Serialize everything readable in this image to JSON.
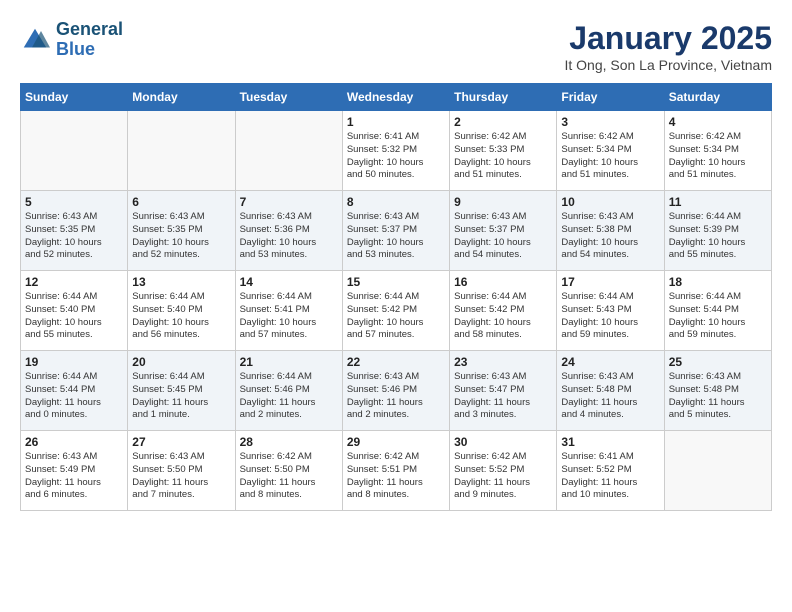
{
  "logo": {
    "line1": "General",
    "line2": "Blue"
  },
  "title": "January 2025",
  "location": "It Ong, Son La Province, Vietnam",
  "weekdays": [
    "Sunday",
    "Monday",
    "Tuesday",
    "Wednesday",
    "Thursday",
    "Friday",
    "Saturday"
  ],
  "weeks": [
    [
      {
        "day": "",
        "text": ""
      },
      {
        "day": "",
        "text": ""
      },
      {
        "day": "",
        "text": ""
      },
      {
        "day": "1",
        "text": "Sunrise: 6:41 AM\nSunset: 5:32 PM\nDaylight: 10 hours\nand 50 minutes."
      },
      {
        "day": "2",
        "text": "Sunrise: 6:42 AM\nSunset: 5:33 PM\nDaylight: 10 hours\nand 51 minutes."
      },
      {
        "day": "3",
        "text": "Sunrise: 6:42 AM\nSunset: 5:34 PM\nDaylight: 10 hours\nand 51 minutes."
      },
      {
        "day": "4",
        "text": "Sunrise: 6:42 AM\nSunset: 5:34 PM\nDaylight: 10 hours\nand 51 minutes."
      }
    ],
    [
      {
        "day": "5",
        "text": "Sunrise: 6:43 AM\nSunset: 5:35 PM\nDaylight: 10 hours\nand 52 minutes."
      },
      {
        "day": "6",
        "text": "Sunrise: 6:43 AM\nSunset: 5:35 PM\nDaylight: 10 hours\nand 52 minutes."
      },
      {
        "day": "7",
        "text": "Sunrise: 6:43 AM\nSunset: 5:36 PM\nDaylight: 10 hours\nand 53 minutes."
      },
      {
        "day": "8",
        "text": "Sunrise: 6:43 AM\nSunset: 5:37 PM\nDaylight: 10 hours\nand 53 minutes."
      },
      {
        "day": "9",
        "text": "Sunrise: 6:43 AM\nSunset: 5:37 PM\nDaylight: 10 hours\nand 54 minutes."
      },
      {
        "day": "10",
        "text": "Sunrise: 6:43 AM\nSunset: 5:38 PM\nDaylight: 10 hours\nand 54 minutes."
      },
      {
        "day": "11",
        "text": "Sunrise: 6:44 AM\nSunset: 5:39 PM\nDaylight: 10 hours\nand 55 minutes."
      }
    ],
    [
      {
        "day": "12",
        "text": "Sunrise: 6:44 AM\nSunset: 5:40 PM\nDaylight: 10 hours\nand 55 minutes."
      },
      {
        "day": "13",
        "text": "Sunrise: 6:44 AM\nSunset: 5:40 PM\nDaylight: 10 hours\nand 56 minutes."
      },
      {
        "day": "14",
        "text": "Sunrise: 6:44 AM\nSunset: 5:41 PM\nDaylight: 10 hours\nand 57 minutes."
      },
      {
        "day": "15",
        "text": "Sunrise: 6:44 AM\nSunset: 5:42 PM\nDaylight: 10 hours\nand 57 minutes."
      },
      {
        "day": "16",
        "text": "Sunrise: 6:44 AM\nSunset: 5:42 PM\nDaylight: 10 hours\nand 58 minutes."
      },
      {
        "day": "17",
        "text": "Sunrise: 6:44 AM\nSunset: 5:43 PM\nDaylight: 10 hours\nand 59 minutes."
      },
      {
        "day": "18",
        "text": "Sunrise: 6:44 AM\nSunset: 5:44 PM\nDaylight: 10 hours\nand 59 minutes."
      }
    ],
    [
      {
        "day": "19",
        "text": "Sunrise: 6:44 AM\nSunset: 5:44 PM\nDaylight: 11 hours\nand 0 minutes."
      },
      {
        "day": "20",
        "text": "Sunrise: 6:44 AM\nSunset: 5:45 PM\nDaylight: 11 hours\nand 1 minute."
      },
      {
        "day": "21",
        "text": "Sunrise: 6:44 AM\nSunset: 5:46 PM\nDaylight: 11 hours\nand 2 minutes."
      },
      {
        "day": "22",
        "text": "Sunrise: 6:43 AM\nSunset: 5:46 PM\nDaylight: 11 hours\nand 2 minutes."
      },
      {
        "day": "23",
        "text": "Sunrise: 6:43 AM\nSunset: 5:47 PM\nDaylight: 11 hours\nand 3 minutes."
      },
      {
        "day": "24",
        "text": "Sunrise: 6:43 AM\nSunset: 5:48 PM\nDaylight: 11 hours\nand 4 minutes."
      },
      {
        "day": "25",
        "text": "Sunrise: 6:43 AM\nSunset: 5:48 PM\nDaylight: 11 hours\nand 5 minutes."
      }
    ],
    [
      {
        "day": "26",
        "text": "Sunrise: 6:43 AM\nSunset: 5:49 PM\nDaylight: 11 hours\nand 6 minutes."
      },
      {
        "day": "27",
        "text": "Sunrise: 6:43 AM\nSunset: 5:50 PM\nDaylight: 11 hours\nand 7 minutes."
      },
      {
        "day": "28",
        "text": "Sunrise: 6:42 AM\nSunset: 5:50 PM\nDaylight: 11 hours\nand 8 minutes."
      },
      {
        "day": "29",
        "text": "Sunrise: 6:42 AM\nSunset: 5:51 PM\nDaylight: 11 hours\nand 8 minutes."
      },
      {
        "day": "30",
        "text": "Sunrise: 6:42 AM\nSunset: 5:52 PM\nDaylight: 11 hours\nand 9 minutes."
      },
      {
        "day": "31",
        "text": "Sunrise: 6:41 AM\nSunset: 5:52 PM\nDaylight: 11 hours\nand 10 minutes."
      },
      {
        "day": "",
        "text": ""
      }
    ]
  ]
}
